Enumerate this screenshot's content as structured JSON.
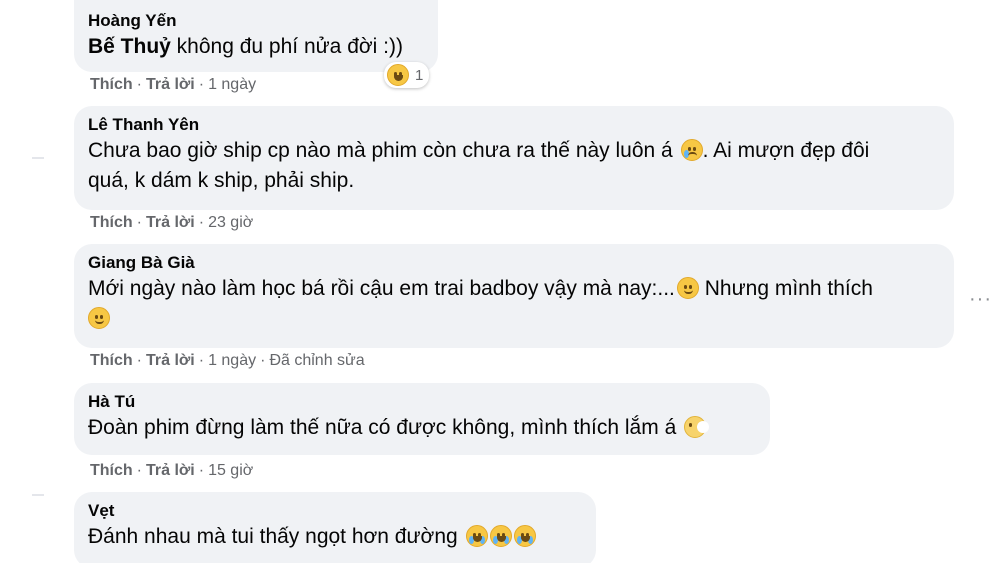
{
  "comments": [
    {
      "author": "Hoàng Yến",
      "mention": "Bế Thuỷ",
      "text": " không đu phí nửa đời :))",
      "like": "Thích",
      "reply": "Trả lời",
      "time": "1 ngày",
      "reaction_count": "1",
      "reaction_icon": "laughing-emoji-icon"
    },
    {
      "author": "Lê Thanh Yên",
      "text_line1": "Chưa bao giờ ship cp nào mà phim còn chưa ra thế này luôn á ",
      "text_line1b": ". Ai mượn đẹp đôi",
      "text_line2": "quá, k dám k ship, phải ship.",
      "like": "Thích",
      "reply": "Trả lời",
      "time": "23 giờ"
    },
    {
      "author": "Giang Bà Già",
      "text_line1": "Mới ngày nào làm học bá rồi cậu em trai badboy vậy mà nay:...",
      "text_line1b": " Nhưng mình thích",
      "like": "Thích",
      "reply": "Trả lời",
      "time": "1 ngày",
      "edited": "Đã chỉnh sửa"
    },
    {
      "author": "Hà Tú",
      "text": "Đoàn phim đừng làm thế nữa có được không, mình thích lắm á ",
      "like": "Thích",
      "reply": "Trả lời",
      "time": "15 giờ"
    },
    {
      "author": "Vẹt",
      "text": "Đánh nhau mà tui thấy ngọt hơn đường "
    }
  ],
  "more_icon": "more-horizontal-icon"
}
